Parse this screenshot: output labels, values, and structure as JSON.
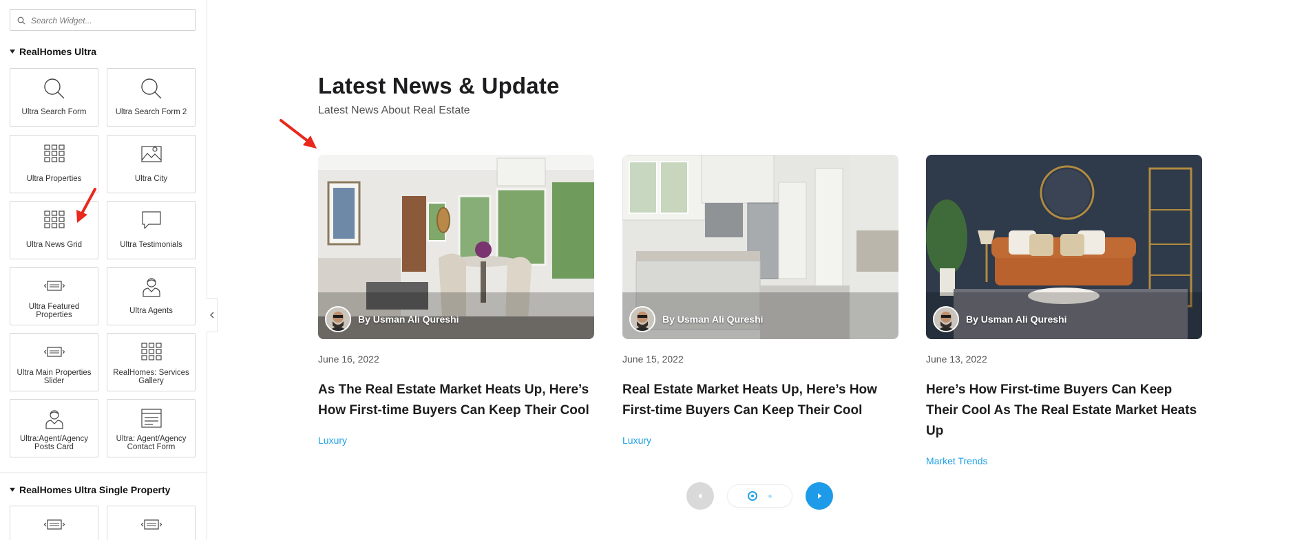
{
  "sidebar": {
    "search": {
      "placeholder": "Search Widget..."
    },
    "section1": {
      "title": "RealHomes Ultra"
    },
    "tiles": [
      {
        "label": "Ultra Search Form",
        "icon": "magnifier-icon"
      },
      {
        "label": "Ultra Search Form 2",
        "icon": "magnifier-icon"
      },
      {
        "label": "Ultra Properties",
        "icon": "grid-icon"
      },
      {
        "label": "Ultra City",
        "icon": "map-icon"
      },
      {
        "label": "Ultra News Grid",
        "icon": "grid-icon"
      },
      {
        "label": "Ultra Testimonials",
        "icon": "speech-bubble-icon"
      },
      {
        "label": "Ultra Featured Properties",
        "icon": "slider-icon"
      },
      {
        "label": "Ultra Agents",
        "icon": "agent-icon"
      },
      {
        "label": "Ultra Main Properties Slider",
        "icon": "slider-icon"
      },
      {
        "label": "RealHomes: Services Gallery",
        "icon": "grid-icon"
      },
      {
        "label": "Ultra:Agent/Agency Posts Card",
        "icon": "agent-icon"
      },
      {
        "label": "Ultra: Agent/Agency Contact Form",
        "icon": "form-window-icon"
      }
    ],
    "section2": {
      "title": "RealHomes Ultra Single Property"
    }
  },
  "main": {
    "title": "Latest News & Update",
    "subtitle": "Latest News About Real Estate",
    "posts": [
      {
        "author": "By Usman Ali Qureshi",
        "date": "June 16, 2022",
        "title": "As The Real Estate Market Heats Up, Here’s How First-time Buyers Can Keep Their Cool",
        "category": "Luxury"
      },
      {
        "author": "By Usman Ali Qureshi",
        "date": "June 15, 2022",
        "title": "Real Estate Market Heats Up, Here’s How First-time Buyers Can Keep Their Cool",
        "category": "Luxury"
      },
      {
        "author": "By Usman Ali Qureshi",
        "date": "June 13, 2022",
        "title": "Here’s How First-time Buyers Can Keep Their Cool As The Real Estate Market Heats Up",
        "category": "Market Trends"
      }
    ],
    "pagination": {
      "active_page": 1,
      "pages": 2
    }
  },
  "colors": {
    "accent": "#1ea0e6",
    "annotation_arrow": "#e8291c",
    "title": "#1d1d1f"
  }
}
